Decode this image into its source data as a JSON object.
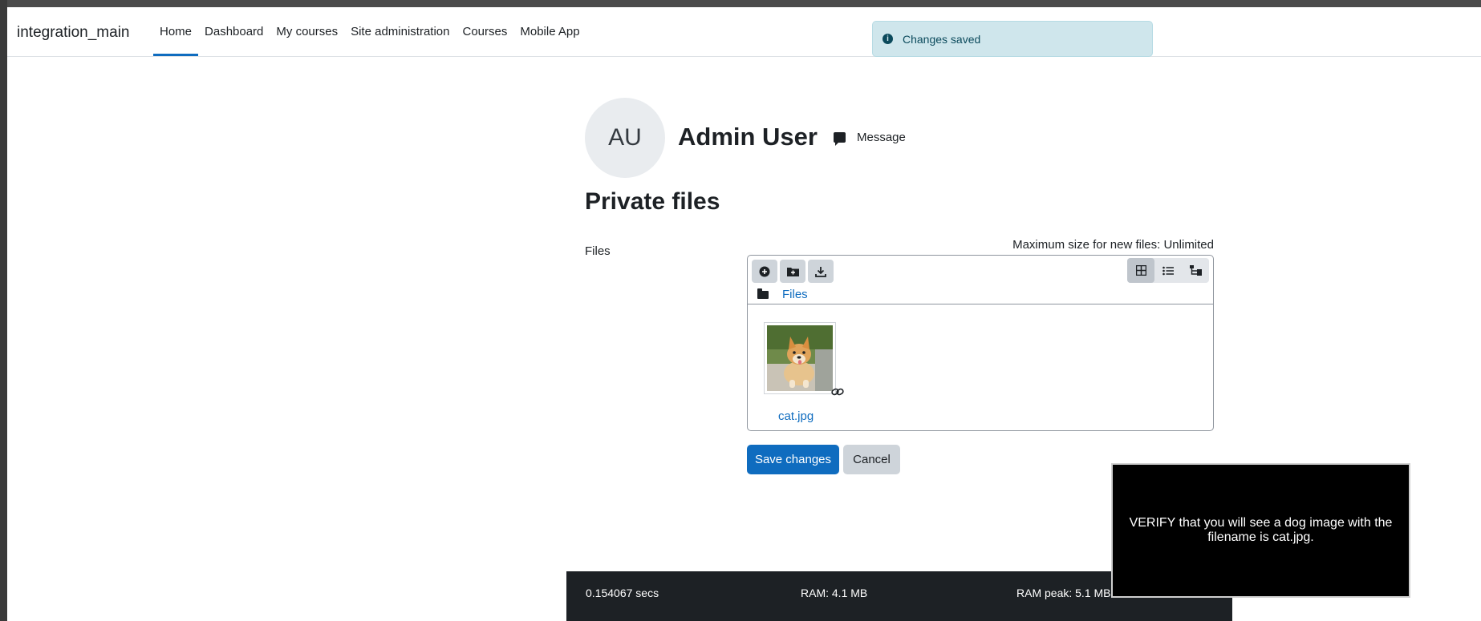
{
  "navbar": {
    "site_name": "integration_main",
    "links": [
      "Home",
      "Dashboard",
      "My courses",
      "Site administration",
      "Courses",
      "Mobile App"
    ]
  },
  "toast": {
    "text": "Changes saved",
    "icon": "info-icon"
  },
  "profile": {
    "initials": "AU",
    "name": "Admin User",
    "message_label": "Message"
  },
  "page": {
    "title": "Private files",
    "field_label": "Files",
    "max_size": "Maximum size for new files: Unlimited"
  },
  "filemanager": {
    "tools": [
      "add-file-icon",
      "create-folder-icon",
      "download-icon"
    ],
    "views": [
      "grid-view-icon",
      "list-view-icon",
      "tree-view-icon"
    ],
    "breadcrumb": "Files",
    "file": {
      "name": "cat.jpg"
    }
  },
  "buttons": {
    "save": "Save changes",
    "cancel": "Cancel"
  },
  "overlay": {
    "text": "VERIFY that you will see a dog image with the filename is cat.jpg."
  },
  "footer": {
    "time": "0.154067 secs",
    "ram": "RAM: 4.1 MB",
    "ram_peak": "RAM peak: 5.1 MB"
  },
  "colors": {
    "primary": "#0f6cbf",
    "footer_bg": "#1d2125",
    "toast_bg": "#cfe6ec"
  }
}
